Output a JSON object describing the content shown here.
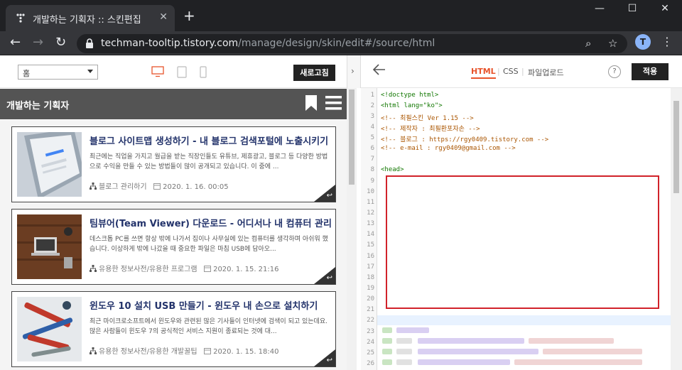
{
  "browser": {
    "tab_title": "개발하는 기획자 :: 스킨편집",
    "url_host": "techman-tooltip.tistory.com",
    "url_path": "/manage/design/skin/edit#/source/html",
    "avatar_letter": "T"
  },
  "preview": {
    "page_select": "홈",
    "refresh_label": "새로고침",
    "blog_title": "개발하는 기획자",
    "posts": [
      {
        "title": "블로그 사이트맵 생성하기 - 내 블로그 검색포털에 노출시키기",
        "excerpt": "최근에는 직업을 가지고 월급을 받는 직장인들도 유튜브, 제휴광고, 블로그 등 다양한 방법으로 수익을 만들 수 있는 방법들이 많이 공개되고 있습니다. 이 중에 ...",
        "category": "블로그 관리하기",
        "date": "2020. 1. 16. 00:05"
      },
      {
        "title": "팀뷰어(Team Viewer) 다운로드 - 어디서나 내 컴퓨터 관리하기",
        "excerpt": "데스크톱 PC를 쓰면 항상 밖에 나가서 집이나 사무실에 있는 컴퓨터를 생각하며 아쉬워 했습니다. 이상하게 밖에 나갔을 때 중요한 파일은 마침 USB에 담아오...",
        "category": "유용한 정보사전/유용한 프로그램",
        "date": "2020. 1. 15. 21:16"
      },
      {
        "title": "윈도우 10 설치 USB 만들기 - 윈도우 내 손으로 설치하기",
        "excerpt": "최근 마이크로소프트에서 윈도우와 관련된 많은 기사들이 인터넷에 검색이 되고 있는데요. 많은 사람들이 윈도우 7의 공식적인 서비스 지원이 종료되는 것에 대...",
        "category": "유용한 정보사전/유용한 개발꿀팁",
        "date": "2020. 1. 15. 18:40"
      }
    ]
  },
  "editor": {
    "tabs": [
      "HTML",
      "CSS",
      "파일업로드"
    ],
    "help_label": "?",
    "apply_label": "적용",
    "code": [
      {
        "n": "1",
        "t": "<!doctype html>"
      },
      {
        "n": "2",
        "t": "<html lang=\"ko\">"
      },
      {
        "n": "3",
        "t": "<!-- 최필스킨 Ver 1.15 -->"
      },
      {
        "n": "4",
        "t": "<!-- 제작자 : 최필환포자손 -->"
      },
      {
        "n": "5",
        "t": "<!-- 블로그 : https://rgy0409.tistory.com -->"
      },
      {
        "n": "6",
        "t": "<!-- e-mail : rgy0409@gmail.com -->"
      },
      {
        "n": "7",
        "t": ""
      },
      {
        "n": "8",
        "t": "<head>"
      }
    ],
    "line_numbers": [
      "9",
      "10",
      "11",
      "12",
      "13",
      "14",
      "15",
      "16",
      "17",
      "18",
      "19",
      "20",
      "21",
      "22",
      "23",
      "24",
      "25",
      "26"
    ]
  }
}
